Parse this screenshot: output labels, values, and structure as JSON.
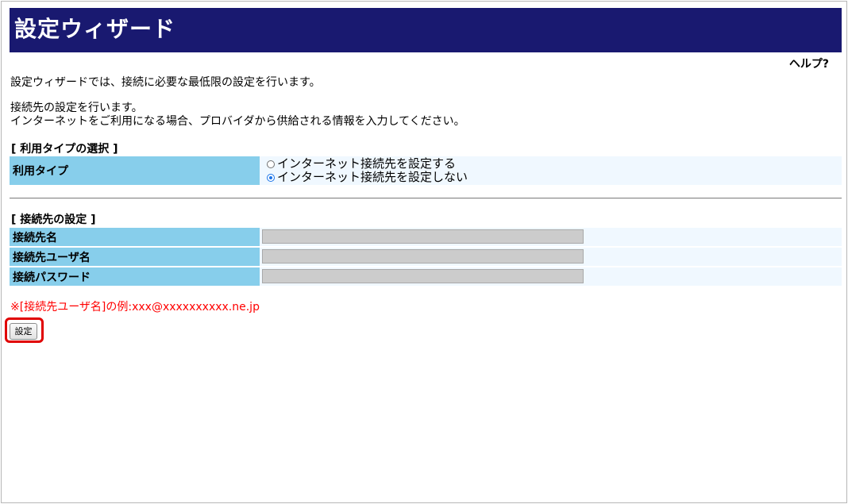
{
  "header": {
    "title": "設定ウィザード"
  },
  "help_link": "ヘルプ?",
  "intro": "設定ウィザードでは、接続に必要な最低限の設定を行います。",
  "description": {
    "line1": "接続先の設定を行います。",
    "line2": "インターネットをご利用になる場合、プロバイダから供給される情報を入力してください。"
  },
  "usage_section": {
    "title": "[ 利用タイプの選択 ]",
    "label": "利用タイプ",
    "options": [
      {
        "label": "インターネット接続先を設定する",
        "selected": false
      },
      {
        "label": "インターネット接続先を設定しない",
        "selected": true
      }
    ]
  },
  "connection_section": {
    "title": "[ 接続先の設定 ]",
    "fields": [
      {
        "label": "接続先名",
        "value": ""
      },
      {
        "label": "接続先ユーザ名",
        "value": ""
      },
      {
        "label": "接続パスワード",
        "value": ""
      }
    ]
  },
  "note": "※[接続先ユーザ名]の例:xxx@xxxxxxxxxx.ne.jp",
  "submit_label": "設定",
  "colors": {
    "header_bg": "#191970",
    "label_bg": "#87ceeb",
    "row_bg": "#f0f8ff",
    "note_text": "#ff0000",
    "highlight": "#e00000"
  }
}
